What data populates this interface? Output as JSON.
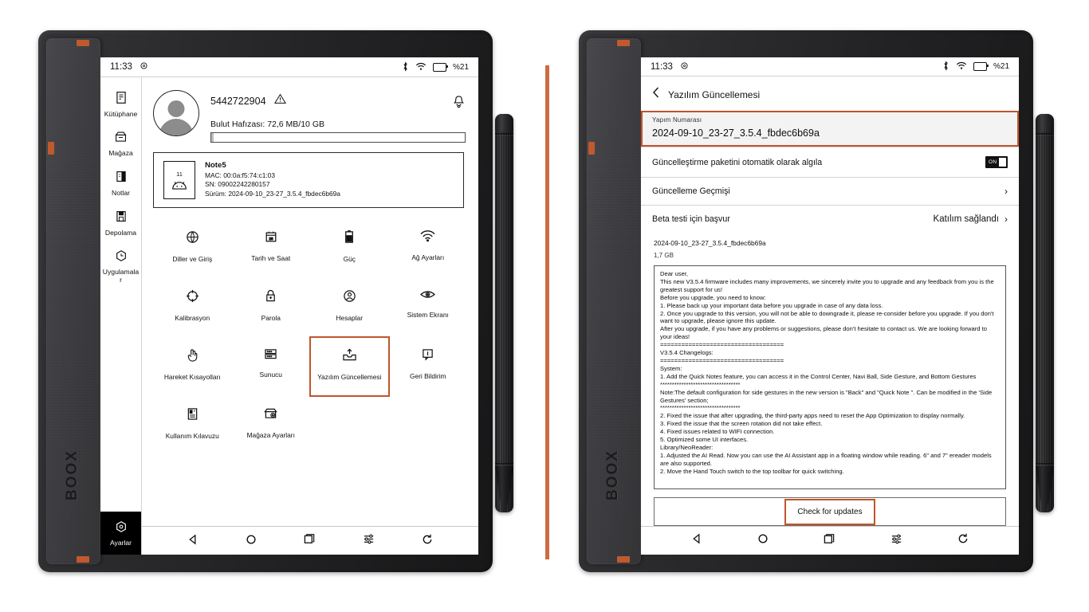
{
  "theme": {
    "accent": "#c0552b",
    "divider": "#cd6b41",
    "shell": "#2a2a2c"
  },
  "left_device": {
    "brand": "BOOX",
    "status_bar": {
      "time": "11:33",
      "settings_icon": "gear-icon",
      "bluetooth_icon": "bluetooth-icon",
      "wifi_icon": "wifi-icon",
      "battery_icon": "battery-icon",
      "battery_level": "%21"
    },
    "sidebar": {
      "items": [
        {
          "label": "Kütüphane",
          "icon": "library-icon",
          "active": false
        },
        {
          "label": "Mağaza",
          "icon": "store-icon",
          "active": false
        },
        {
          "label": "Notlar",
          "icon": "notes-icon",
          "active": false
        },
        {
          "label": "Depolama",
          "icon": "storage-icon",
          "active": false
        },
        {
          "label": "Uygulamalar",
          "icon": "apps-icon",
          "active": false
        }
      ],
      "bottom_item": {
        "label": "Ayarlar",
        "icon": "settings-gear-icon",
        "active": true
      }
    },
    "profile": {
      "avatar_icon": "user-avatar-icon",
      "account_name": "5442722904",
      "warning_icon": "warning-triangle-icon",
      "notification_icon": "bell-icon",
      "cloud_storage_label": "Bulut Hafızası: 72,6 MB/10 GB",
      "cloud_used_percent": 1
    },
    "device_card": {
      "icon_number": "11",
      "icon": "android-device-icon",
      "model": "Note5",
      "mac": "MAC: 00:0a:f5:74:c1:03",
      "sn": "SN: 09002242280157",
      "version": "Sürüm: 2024-09-10_23-27_3.5.4_fbdec6b69a"
    },
    "settings_grid": [
      {
        "label": "Diller ve Giriş",
        "icon": "globe-icon",
        "highlight": false
      },
      {
        "label": "Tarih ve Saat",
        "icon": "calendar-icon",
        "highlight": false
      },
      {
        "label": "Güç",
        "icon": "power-battery-icon",
        "highlight": false
      },
      {
        "label": "Ağ Ayarları",
        "icon": "wifi-icon",
        "highlight": false
      },
      {
        "label": "Kalibrasyon",
        "icon": "calibration-icon",
        "highlight": false
      },
      {
        "label": "Parola",
        "icon": "lock-icon",
        "highlight": false
      },
      {
        "label": "Hesaplar",
        "icon": "account-icon",
        "highlight": false
      },
      {
        "label": "Sistem Ekranı",
        "icon": "eye-icon",
        "highlight": false
      },
      {
        "label": "Hareket Kısayolları",
        "icon": "hand-gesture-icon",
        "highlight": false
      },
      {
        "label": "Sunucu",
        "icon": "server-icon",
        "highlight": false
      },
      {
        "label": "Yazılım Güncellemesi",
        "icon": "software-update-icon",
        "highlight": true
      },
      {
        "label": "Geri Bildirim",
        "icon": "feedback-icon",
        "highlight": false
      },
      {
        "label": "Kullanım Kılavuzu",
        "icon": "manual-icon",
        "highlight": false
      },
      {
        "label": "Mağaza Ayarları",
        "icon": "store-settings-icon",
        "highlight": false
      }
    ],
    "navbar": [
      {
        "icon": "back-triangle-icon"
      },
      {
        "icon": "home-circle-icon"
      },
      {
        "icon": "recents-square-icon"
      },
      {
        "icon": "sliders-icon"
      },
      {
        "icon": "refresh-icon"
      }
    ]
  },
  "right_device": {
    "brand": "BOOX",
    "status_bar": {
      "time": "11:33",
      "settings_icon": "gear-icon",
      "bluetooth_icon": "bluetooth-icon",
      "wifi_icon": "wifi-icon",
      "battery_icon": "battery-icon",
      "battery_level": "%21"
    },
    "header": {
      "back_icon": "back-chevron-icon",
      "title": "Yazılım Güncellemesi"
    },
    "build": {
      "caption": "Yapım Numarası",
      "value": "2024-09-10_23-27_3.5.4_fbdec6b69a",
      "highlight": true
    },
    "rows": [
      {
        "label": "Güncelleştirme paketini otomatik olarak algıla",
        "control": "toggle",
        "toggle_text": "ON",
        "toggle_state": "on"
      },
      {
        "label": "Güncelleme Geçmişi",
        "control": "chevron",
        "value": ""
      },
      {
        "label": "Beta testi için başvur",
        "control": "chevron",
        "value": "Katılım sağlandı"
      }
    ],
    "package": {
      "name": "2024-09-10_23-27_3.5.4_fbdec6b69a",
      "size": "1,7 GB"
    },
    "changelog": "Dear user,\nThis new V3.5.4 firmware includes many improvements, we sincerely invite you to upgrade and any feedback from you is the greatest support for us!\nBefore you upgrade, you need to know:\n1. Please back up your important data before you upgrade in case of any data loss.\n2. Once you upgrade to this version, you will not be able to downgrade it, please re-consider before you upgrade. If you don't want to upgrade, please ignore this update.\nAfter you upgrade, if you have any problems or suggestions, please don't hesitate to contact us. We are looking forward to your ideas!\n===================================\nV3.5.4 Changelogs:\n===================================\nSystem:\n1. Add the Quick Notes feature, you can access it in the Control Center, Navi Ball, Side Gesture, and Bottom Gestures\n**********************************\nNote:The default configuration for side gestures in the new version is \"Back\" and \"Quick Note \". Can be modified in the 'Side Gestures' section;\n**********************************\n2. Fixed the issue that after upgrading, the third-party apps need to reset the App Optimization to display normally.\n3. Fixed the issue that the screen rotation did not take effect.\n4. Fixed issues related to WIFI connection.\n5. Optimized some UI interfaces.\nLibrary/NeoReader:\n1. Adjusted the AI Read. Now you can use the AI Assistant app in a floating window while reading. 6\" and 7\" ereader models are also supported.\n2. Move the Hand Touch switch to the top toolbar for quick switching.",
    "check_button": {
      "label": "Check for updates",
      "highlight": true
    },
    "navbar": [
      {
        "icon": "back-triangle-icon"
      },
      {
        "icon": "home-circle-icon"
      },
      {
        "icon": "recents-square-icon"
      },
      {
        "icon": "sliders-icon"
      },
      {
        "icon": "refresh-icon"
      }
    ]
  }
}
